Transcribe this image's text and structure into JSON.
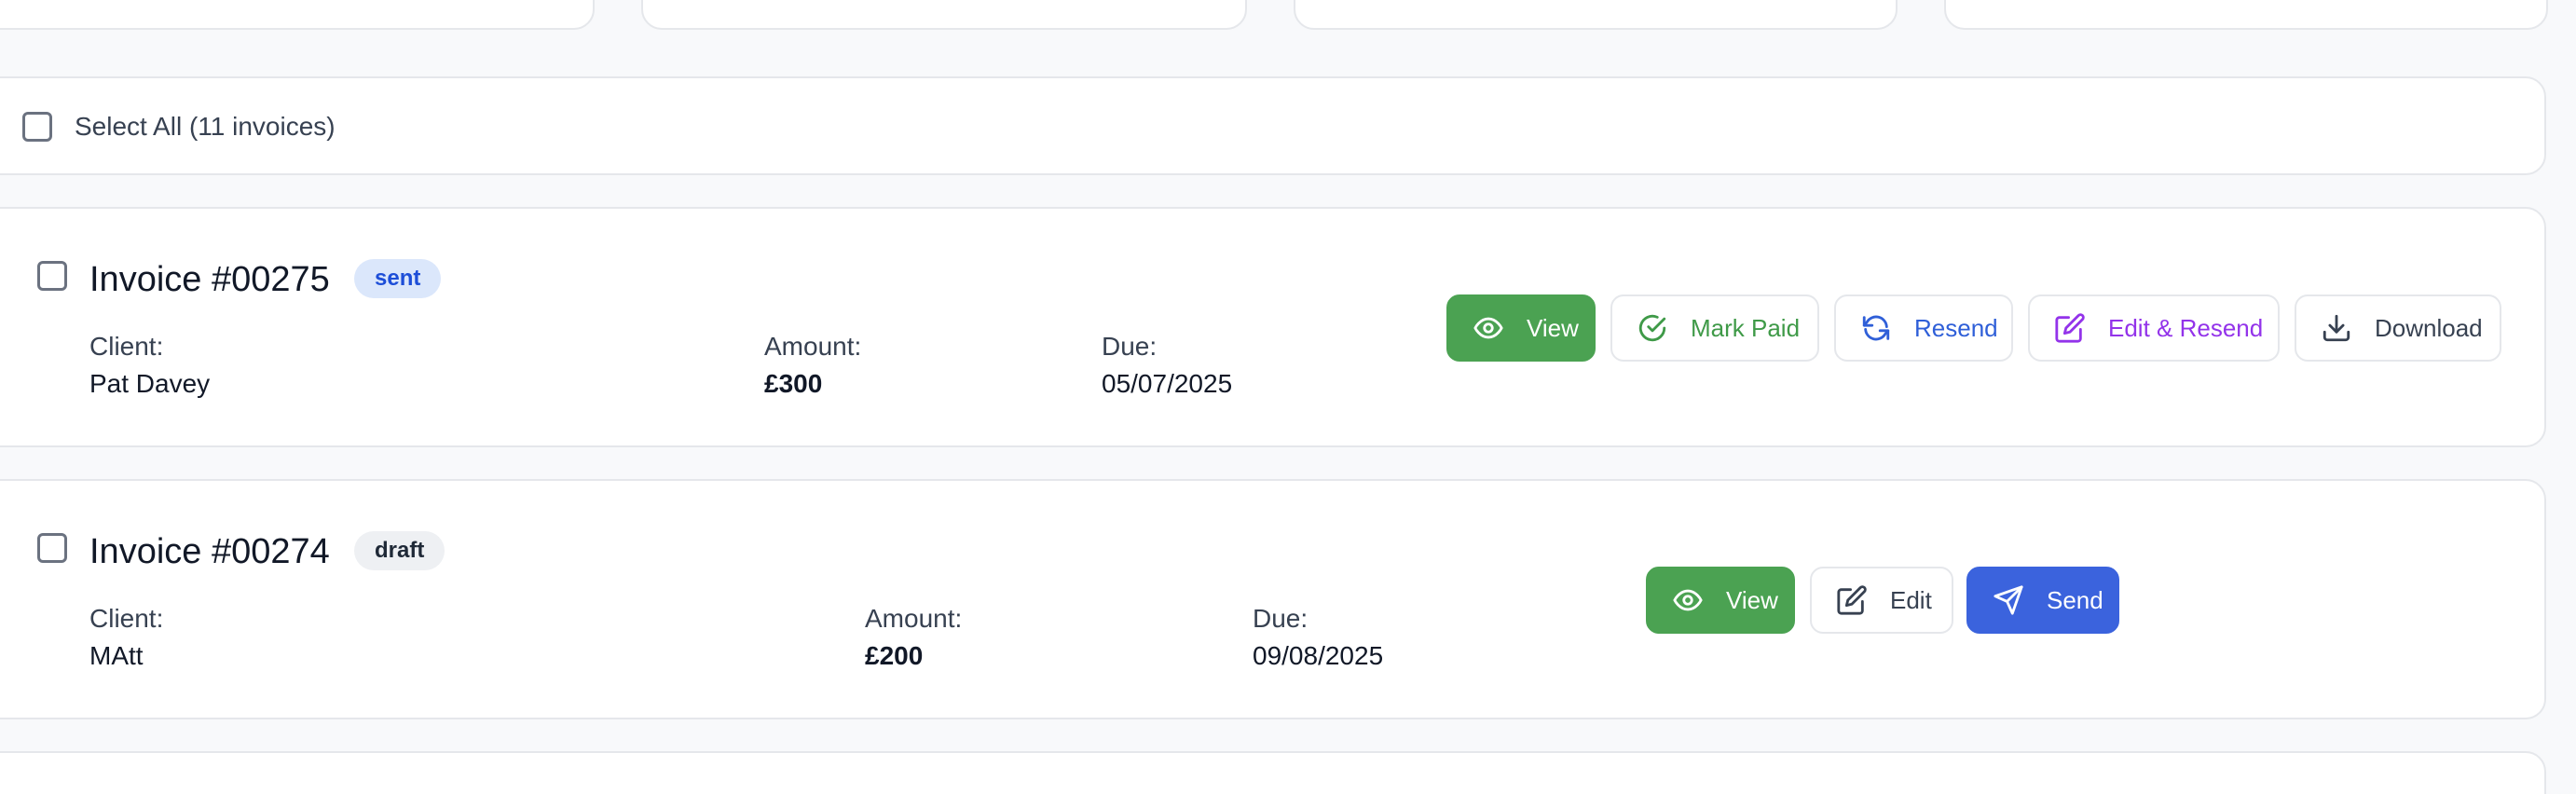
{
  "select_all": {
    "label": "Select All (11 invoices)"
  },
  "invoices": [
    {
      "title": "Invoice #00275",
      "status": "sent",
      "client_label": "Client:",
      "client": "Pat Davey",
      "amount_label": "Amount:",
      "amount": "£300",
      "due_label": "Due:",
      "due": "05/07/2025",
      "actions": {
        "view": "View",
        "mark_paid": "Mark Paid",
        "resend": "Resend",
        "edit_resend": "Edit & Resend",
        "download": "Download"
      }
    },
    {
      "title": "Invoice #00274",
      "status": "draft",
      "client_label": "Client:",
      "client": "MAtt",
      "amount_label": "Amount:",
      "amount": "£200",
      "due_label": "Due:",
      "due": "09/08/2025",
      "actions": {
        "view": "View",
        "edit": "Edit",
        "send": "Send"
      }
    }
  ],
  "colors": {
    "view_button": "#4ba252",
    "send_button": "#3b63dd",
    "mark_paid_text": "#3f9a48",
    "resend_text": "#2f5fd8",
    "edit_resend_text": "#9333ea",
    "badge_sent_bg": "#dbe7fb",
    "badge_draft_bg": "#eef0f3"
  },
  "icons": [
    "eye-icon",
    "check-circle-icon",
    "refresh-icon",
    "edit-icon",
    "download-icon",
    "send-icon"
  ]
}
